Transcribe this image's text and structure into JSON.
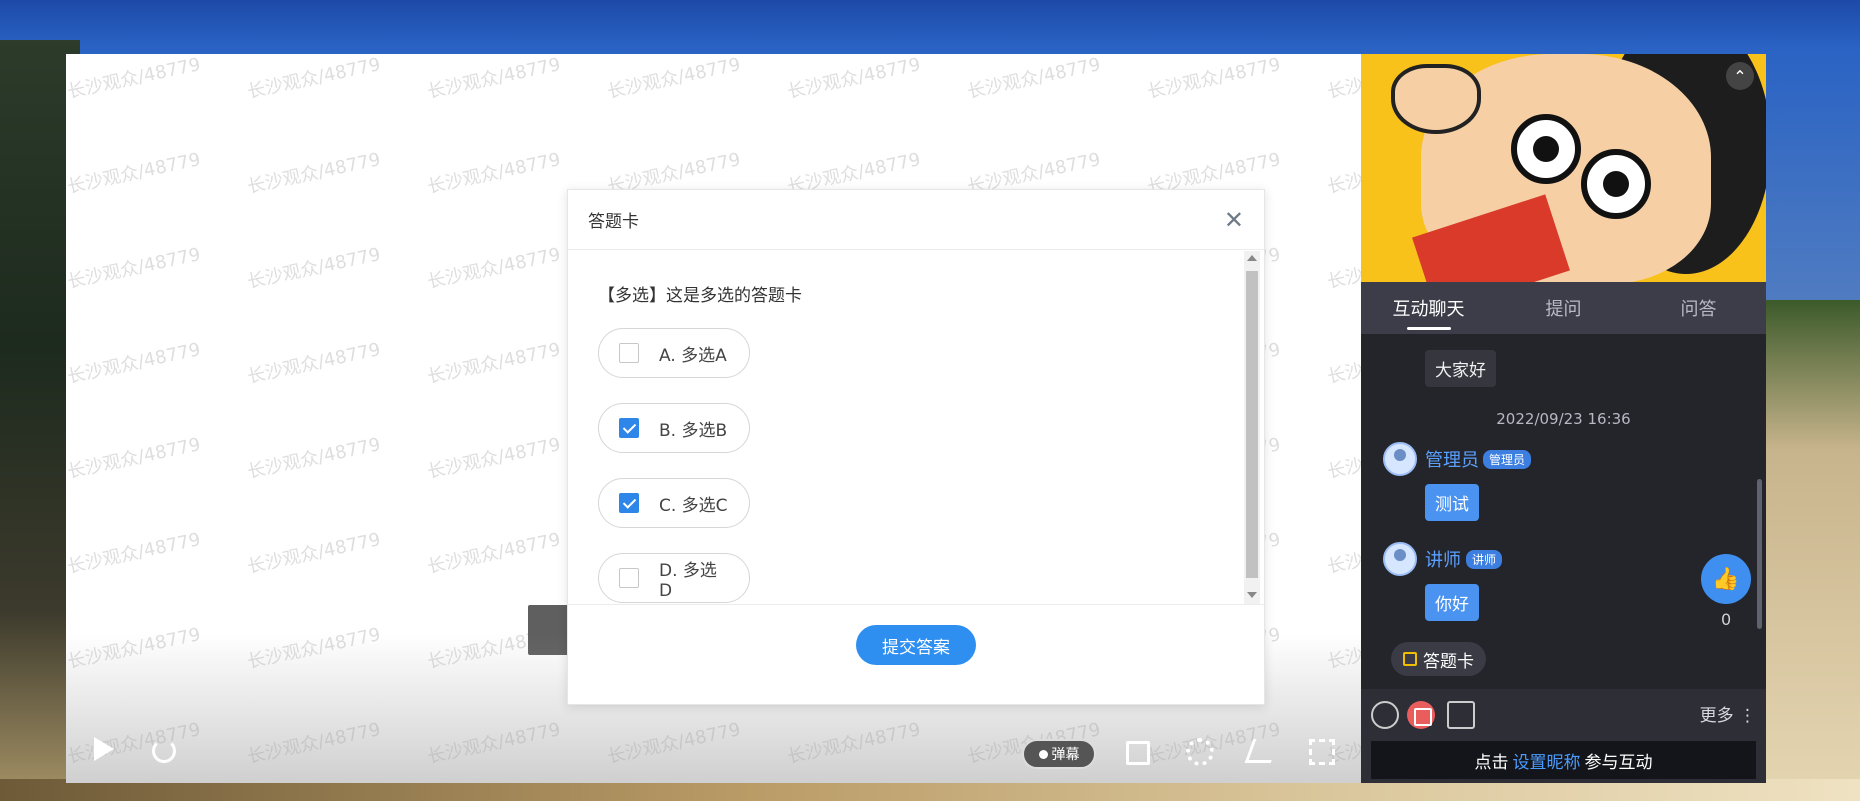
{
  "watermark_text": "长沙观众/48779",
  "player": {
    "danmu_label": "弹幕"
  },
  "modal": {
    "title": "答题卡",
    "question": "【多选】这是多选的答题卡",
    "options": [
      {
        "label": "A. 多选A",
        "checked": false
      },
      {
        "label": "B. 多选B",
        "checked": true
      },
      {
        "label": "C. 多选C",
        "checked": true
      },
      {
        "label": "D. 多选D",
        "checked": false
      }
    ],
    "submit_label": "提交答案"
  },
  "side": {
    "tabs": [
      {
        "label": "互动聊天",
        "active": true
      },
      {
        "label": "提问",
        "active": false
      },
      {
        "label": "问答",
        "active": false
      }
    ],
    "chat": {
      "msg1": "大家好",
      "timestamp": "2022/09/23 16:36",
      "admin_name": "管理员",
      "admin_badge": "管理员",
      "admin_msg": "测试",
      "lecturer_name": "讲师",
      "lecturer_badge": "讲师",
      "lecturer_msg": "你好"
    },
    "like_count": "0",
    "answer_card_chip": "答题卡",
    "more_label": "更多",
    "join": {
      "prefix": "点击",
      "link": "设置昵称",
      "suffix": "参与互动"
    }
  },
  "colors": {
    "accent": "#2e8ff0",
    "chat_name": "#5aa0ff",
    "panel_bg": "#24252b"
  }
}
